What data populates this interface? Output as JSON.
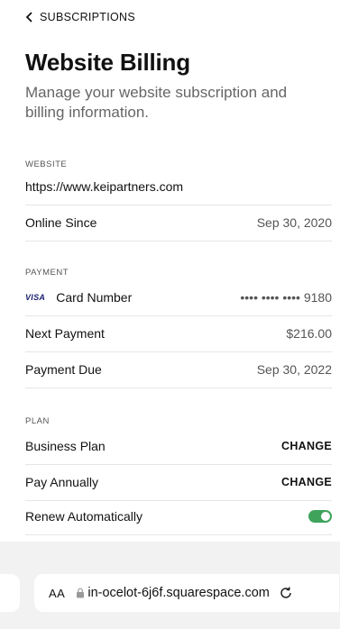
{
  "nav": {
    "back_label": "SUBSCRIPTIONS"
  },
  "header": {
    "title": "Website Billing",
    "subtitle": "Manage your website subscription and billing information."
  },
  "website": {
    "label": "WEBSITE",
    "url": "https://www.keipartners.com",
    "online_since_label": "Online Since",
    "online_since_value": "Sep 30, 2020"
  },
  "payment": {
    "label": "PAYMENT",
    "card_brand": "VISA",
    "card_number_label": "Card Number",
    "card_number_value": "•••• •••• •••• 9180",
    "next_payment_label": "Next Payment",
    "next_payment_value": "$216.00",
    "payment_due_label": "Payment Due",
    "payment_due_value": "Sep 30, 2022"
  },
  "plan": {
    "label": "PLAN",
    "plan_name": "Business Plan",
    "plan_action": "CHANGE",
    "billing_cycle": "Pay Annually",
    "billing_action": "CHANGE",
    "renew_label": "Renew Automatically",
    "renew_on": true
  },
  "browser": {
    "text_size_label": "AA",
    "url": "in-ocelot-6j6f.squarespace.com"
  },
  "colors": {
    "toggle_on": "#3fa35b",
    "visa_blue": "#1a1f71"
  }
}
